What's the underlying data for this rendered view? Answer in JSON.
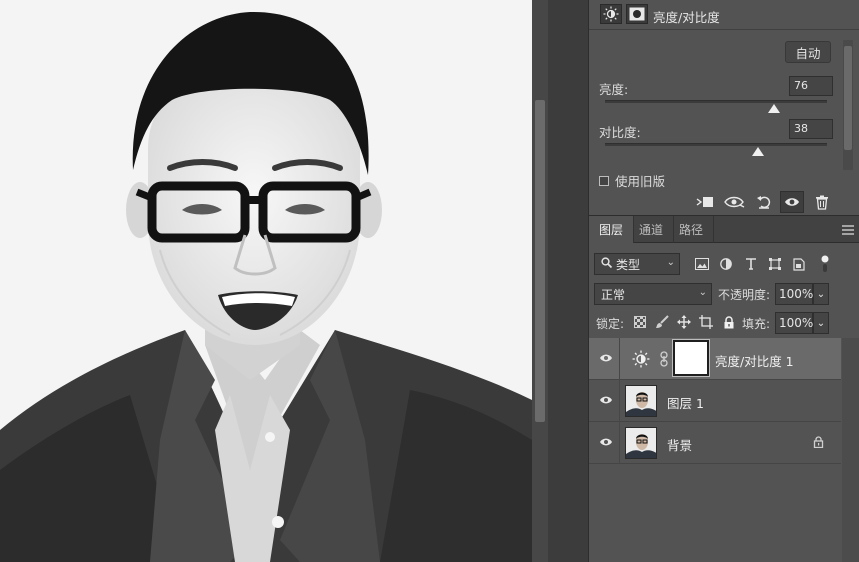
{
  "properties": {
    "title": "亮度/对比度",
    "auto_label": "自动",
    "brightness": {
      "label": "亮度:",
      "value": "76",
      "level": 0.76
    },
    "contrast": {
      "label": "对比度:",
      "value": "38",
      "level": 0.69
    },
    "legacy_label": "使用旧版",
    "icons": [
      "adjustment-sun-icon",
      "mask-icon",
      "clip-to-layer-icon",
      "view-previous-icon",
      "reset-icon",
      "visibility-icon",
      "delete-icon"
    ]
  },
  "layers_panel": {
    "tabs": [
      {
        "label": "图层",
        "active": true
      },
      {
        "label": "通道",
        "active": false
      },
      {
        "label": "路径",
        "active": false
      }
    ],
    "filter_kind": "类型",
    "blend_mode": "正常",
    "opacity_label": "不透明度:",
    "opacity_value": "100%",
    "lock_label": "锁定:",
    "fill_label": "填充:",
    "fill_value": "100%",
    "layers": [
      {
        "name": "亮度/对比度 1",
        "type": "adjustment",
        "selected": true
      },
      {
        "name": "图层 1",
        "type": "pixel",
        "selected": false
      },
      {
        "name": "背景",
        "type": "background",
        "locked": true,
        "selected": false
      }
    ]
  },
  "colors": {
    "panel_bg": "#535353",
    "selected_row": "#6a6a6a",
    "canvas_bg": "#f4f4f4"
  }
}
